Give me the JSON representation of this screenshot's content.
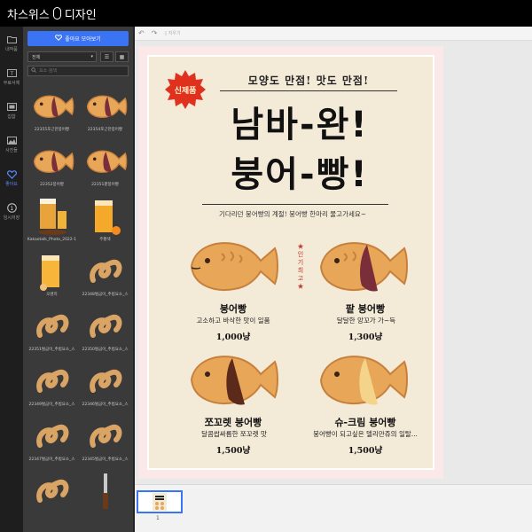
{
  "app": {
    "title": "차스위스",
    "title_suffix": "디자인"
  },
  "rail": {
    "items": [
      {
        "label": "내작품",
        "icon": "folder-icon"
      },
      {
        "label": "무료서체",
        "icon": "font-icon"
      },
      {
        "label": "집합",
        "icon": "collection-icon"
      },
      {
        "label": "사진들",
        "icon": "photo-icon"
      },
      {
        "label": "좋아요",
        "icon": "heart-icon"
      },
      {
        "label": "임시저장",
        "icon": "temp-save-icon"
      }
    ]
  },
  "panel": {
    "fav_button": "좋아요 모아보기",
    "filter_value": "전체",
    "search_placeholder": "요소 검색",
    "assets": [
      {
        "caption": "22355포근한붕어빵",
        "kind": "fish"
      },
      {
        "caption": "22354포근한붕어빵",
        "kind": "fish"
      },
      {
        "caption": "22352붕어빵",
        "kind": "fish"
      },
      {
        "caption": "22351팥붕어빵",
        "kind": "fish-red"
      },
      {
        "caption": "Kakaotalk_Photo_2022-1",
        "kind": "beer"
      },
      {
        "caption": "주황색",
        "kind": "juice"
      },
      {
        "caption": "오렌지",
        "kind": "juice2"
      },
      {
        "caption": "22348벌금이_추범요소_스",
        "kind": "swirl"
      },
      {
        "caption": "22351벌금이_추범요소_스",
        "kind": "swirl"
      },
      {
        "caption": "22350벌금이_추범요소_스",
        "kind": "swirl"
      },
      {
        "caption": "22349벌금이_추범요소_스",
        "kind": "swirl"
      },
      {
        "caption": "22346벌금이_추범요소_스",
        "kind": "swirl"
      },
      {
        "caption": "22347벌금이_추범요소_스",
        "kind": "swirl"
      },
      {
        "caption": "22345벌금이_추범요소_스",
        "kind": "swirl"
      },
      {
        "caption": "",
        "kind": "swirl"
      },
      {
        "caption": "",
        "kind": "knife"
      }
    ]
  },
  "toolbar": {
    "clear_label": "지우기"
  },
  "poster": {
    "badge": "신제품",
    "subtitle": "모양도 만점! 맛도 만점!",
    "title1": "남바-완!",
    "title2": "붕어-빵!",
    "tagline": "기다리던 붕어빵의 계절! 붕어빵 한마리 물고가세요~",
    "popular": "★ 인 기 최 고 ★",
    "items": [
      {
        "name": "붕어빵",
        "desc": "고소하고 바삭한 맛이 일품",
        "price": "1,000냥"
      },
      {
        "name": "팥 붕어빵",
        "desc": "달달한 앙꼬가 가~득",
        "price": "1,300냥"
      },
      {
        "name": "쪼꼬렛 붕어빵",
        "desc": "달콤쌉싸름한 쪼꼬렛 맛",
        "price": "1,500냥"
      },
      {
        "name": "슈-크림 붕어빵",
        "desc": "붕어빵이 되고싶은 델리만쥬의 일탈...",
        "price": "1,500냥"
      }
    ]
  },
  "pages": {
    "current": "1"
  },
  "colors": {
    "accent": "#3b73f5",
    "fish": "#e8a659",
    "fish_dark": "#c7803b",
    "red_bean": "#7a2e3a",
    "chocolate": "#5b2a1a"
  }
}
